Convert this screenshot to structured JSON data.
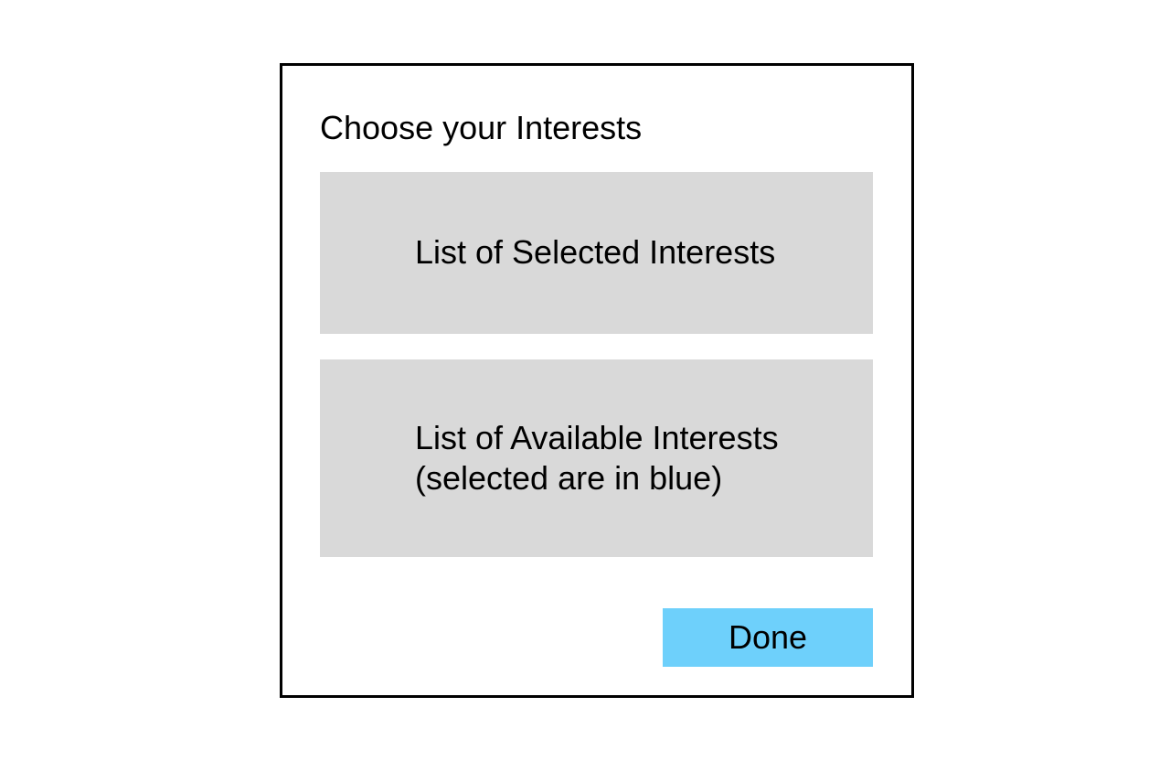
{
  "dialog": {
    "title": "Choose your Interests",
    "selected_panel": {
      "text": "List of Selected Interests"
    },
    "available_panel": {
      "line1": "List of Available Interests",
      "line2": "(selected are in blue)"
    },
    "done_button": {
      "label": "Done"
    }
  },
  "colors": {
    "panel_background": "#d9d9d9",
    "button_accent": "#6ed0fb",
    "border": "#000000"
  }
}
